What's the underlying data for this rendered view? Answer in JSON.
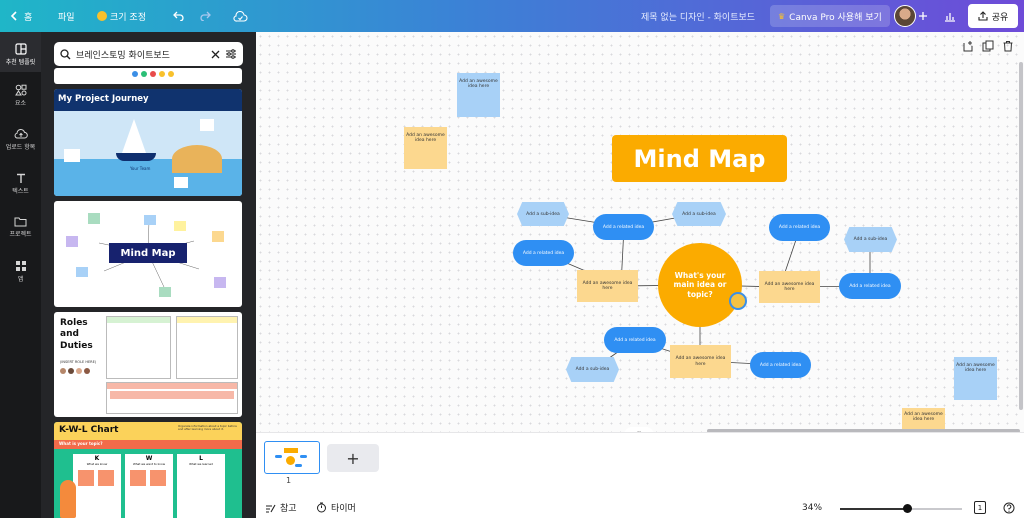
{
  "topbar": {
    "back_icon": "chevron-left-icon",
    "home_label": "홈",
    "file_label": "파일",
    "resize_label": "크기 조정",
    "undo_icon": "undo-icon",
    "redo_icon": "redo-icon",
    "cloud_icon": "cloud-check-icon",
    "doc_title": "제목 없는 디자인 - 화이트보드",
    "pro_label": "Canva Pro 사용해 보기",
    "add_icon": "plus-icon",
    "analytics_icon": "bar-chart-icon",
    "share_label": "공유",
    "share_icon": "upload-icon"
  },
  "rail": {
    "items": [
      {
        "label": "추천 템플릿",
        "icon": "template-icon",
        "active": true
      },
      {
        "label": "요소",
        "icon": "elements-icon"
      },
      {
        "label": "업로드 항목",
        "icon": "cloud-upload-icon"
      },
      {
        "label": "텍스트",
        "icon": "text-icon"
      },
      {
        "label": "프로젝트",
        "icon": "folder-icon"
      },
      {
        "label": "앱",
        "icon": "apps-grid-icon"
      }
    ]
  },
  "panel": {
    "search_value": "브레인스토밍 화이트보드",
    "templates": [
      {
        "title": "My Project Journey",
        "labels": [
          "Your Team"
        ]
      },
      {
        "title": "Mind Map"
      },
      {
        "title": "Roles and Duties",
        "subtitle": "(INSERT ROLE HERE)"
      },
      {
        "title": "K-W-L Chart",
        "subtitle": "What is your topic?",
        "description": "Organize information about a topic before and after learning more about it.",
        "columns": [
          "K",
          "W",
          "L"
        ],
        "column_sub": [
          "What we know",
          "What we want to know",
          "What we learned"
        ]
      }
    ]
  },
  "canvas": {
    "title": "Mind Map",
    "center_text": "What's your main idea or topic?",
    "awesome_text": "Add an awesome idea here",
    "related_text": "Add a related idea",
    "sub_text": "Add a sub-idea",
    "top_icons": [
      "add-page-icon",
      "duplicate-icon",
      "trash-icon"
    ],
    "collapse_icon": "chevron-down-icon",
    "side_toggle_icon": "chevron-left-icon"
  },
  "pages": {
    "current_page": "1",
    "add_page_label": "+"
  },
  "footer": {
    "notes_label": "참고",
    "timer_label": "타이머",
    "zoom": "34%",
    "zoom_fraction": 0.55,
    "page_count": "1",
    "help_icon": "help-icon"
  },
  "colors": {
    "accent_blue": "#2f8ff3",
    "mind_map_orange": "#fbab00",
    "sticky_blue": "#a8d1f7",
    "sticky_yellow": "#fcd88f"
  }
}
